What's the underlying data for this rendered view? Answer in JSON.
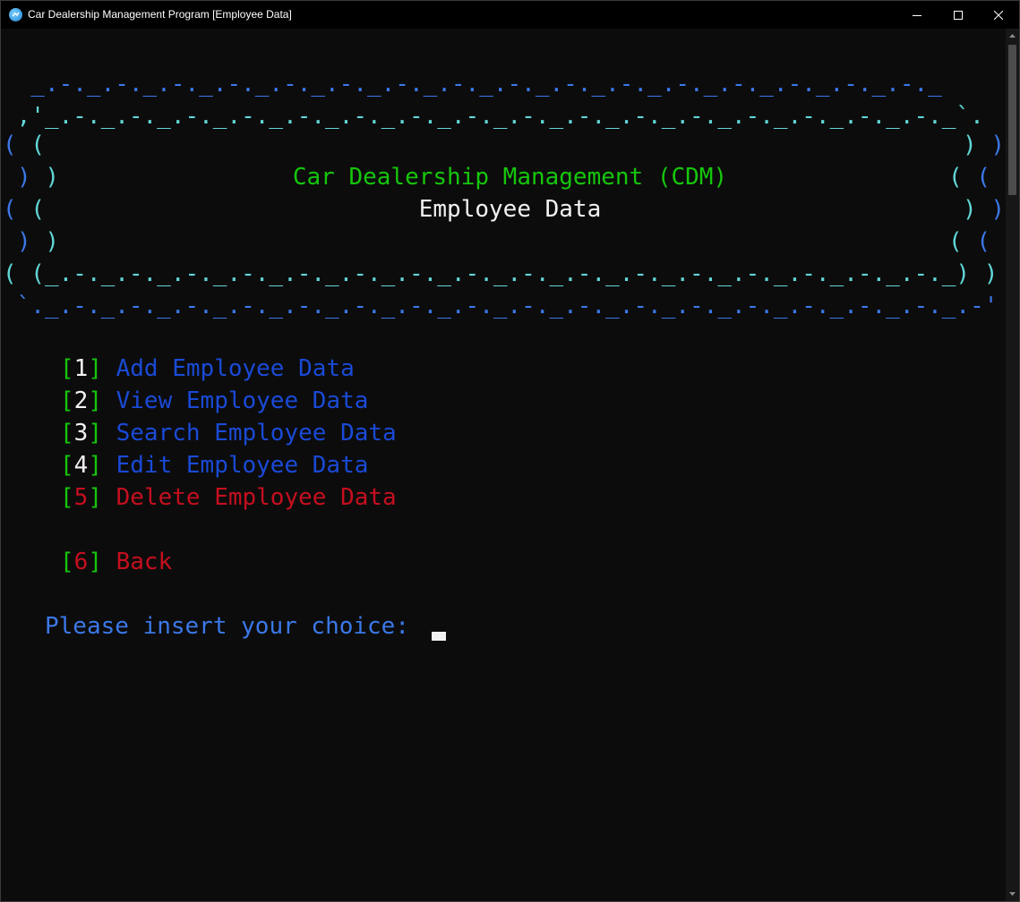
{
  "window": {
    "title": "Car Dealership Management Program [Employee Data]"
  },
  "banner": {
    "top_edge_1": "  _.-._.-._.-._.-._.-._.-._.-._.-._.-._.-._.-._.-._.-._.-._.-._.-._",
    "top_edge_2": " ,'_.-._.-._.-._.-._.-._.-._.-._.-._.-._.-._.-._.-._.-._.-._.-._.-._`.",
    "bottom_edge_1": "( (_.-._.-._.-._.-._.-._.-._.-._.-._.-._.-._.-._.-._.-._.-._.-._.-._) )",
    "bottom_edge_2": " `._.-._.-._.-._.-._.-._.-._.-._.-._.-._.-._.-._.-._.-._.-._.-._.-._.-'",
    "paren_left_outer": "(",
    "paren_left_inner": "(",
    "paren_right_outer": ")",
    "paren_right_inner": ")",
    "title": "Car Dealership Management (CDM)",
    "subtitle": "Employee Data"
  },
  "menu": [
    {
      "number": "1",
      "label": "Add Employee Data"
    },
    {
      "number": "2",
      "label": "View Employee Data"
    },
    {
      "number": "3",
      "label": "Search Employee Data"
    },
    {
      "number": "4",
      "label": "Edit Employee Data"
    },
    {
      "number": "5",
      "label": "Delete Employee Data"
    },
    {
      "number": "6",
      "label": "Back"
    }
  ],
  "prompt": {
    "text": "Please insert your choice: "
  },
  "colors": {
    "background": "#0c0c0c",
    "banner_blue": "#3b78e7",
    "banner_cyan": "#61d6d6",
    "title_green": "#16c60c",
    "menu_blue": "#1a4ad6",
    "menu_red": "#c50f1f",
    "bracket_green": "#16c60c"
  }
}
